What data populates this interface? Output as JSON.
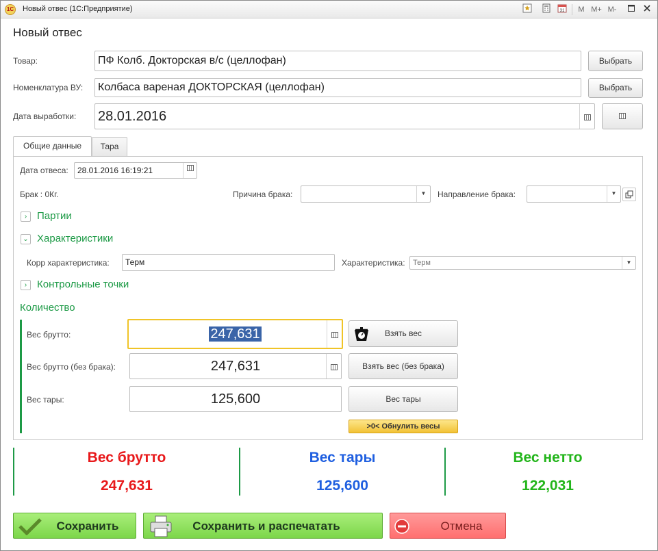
{
  "window": {
    "title": "Новый отвес  (1С:Предприятие)",
    "logo_text": "1С",
    "toolbar": [
      "M",
      "M+",
      "M-"
    ]
  },
  "form": {
    "title": "Новый отвес"
  },
  "fields": {
    "product_label": "Товар:",
    "product_value": "ПФ Колб. Докторская  в/с  (целлофан)",
    "nomenclature_label": "Номенклатура ВУ:",
    "nomenclature_value": "Колбаса вареная ДОКТОРСКАЯ (целлофан)",
    "production_date_label": "Дата выработки:",
    "production_date_value": "28.01.2016",
    "select_label": "Выбрать"
  },
  "tabs": [
    {
      "label": "Общие данные",
      "active": true
    },
    {
      "label": "Тара",
      "active": false
    }
  ],
  "general": {
    "weigh_date_label": "Дата отвеса:",
    "weigh_date_value": "28.01.2016 16:19:21",
    "defect_text": "Брак : 0Кг.",
    "defect_reason_label": "Причина брака:",
    "defect_reason_value": "",
    "defect_direction_label": "Направление брака:",
    "defect_direction_value": ""
  },
  "groups": {
    "batches": "Партии",
    "characteristics": "Характеристики",
    "control_points": "Контрольные точки",
    "quantity": "Количество"
  },
  "characteristics": {
    "corr_label": "Корр характеристика:",
    "corr_value": "Терм",
    "char_label": "Характеристика:",
    "char_value": "Терм"
  },
  "weights": {
    "gross_label": "Вес брутто:",
    "gross_value": "247,631",
    "gross_nodefect_label": "Вес брутто (без брака):",
    "gross_nodefect_value": "247,631",
    "tare_label": "Вес тары:",
    "tare_value": "125,600",
    "take_weight_btn": "Взять вес",
    "take_weight_nodefect_btn": "Взять вес (без брака)",
    "tare_btn": "Вес тары",
    "reset_btn": ">0< Обнулить весы"
  },
  "summary": {
    "gross_title": "Вес брутто",
    "gross_value": "247,631",
    "tare_title": "Вес  тары",
    "tare_value": "125,600",
    "net_title": "Вес нетто",
    "net_value": "122,031",
    "colors": {
      "gross": "#e8191b",
      "tare": "#1f5fe0",
      "net": "#23b51b"
    }
  },
  "actions": {
    "save": "Сохранить",
    "save_print": "Сохранить и распечатать",
    "cancel": "Отмена"
  }
}
